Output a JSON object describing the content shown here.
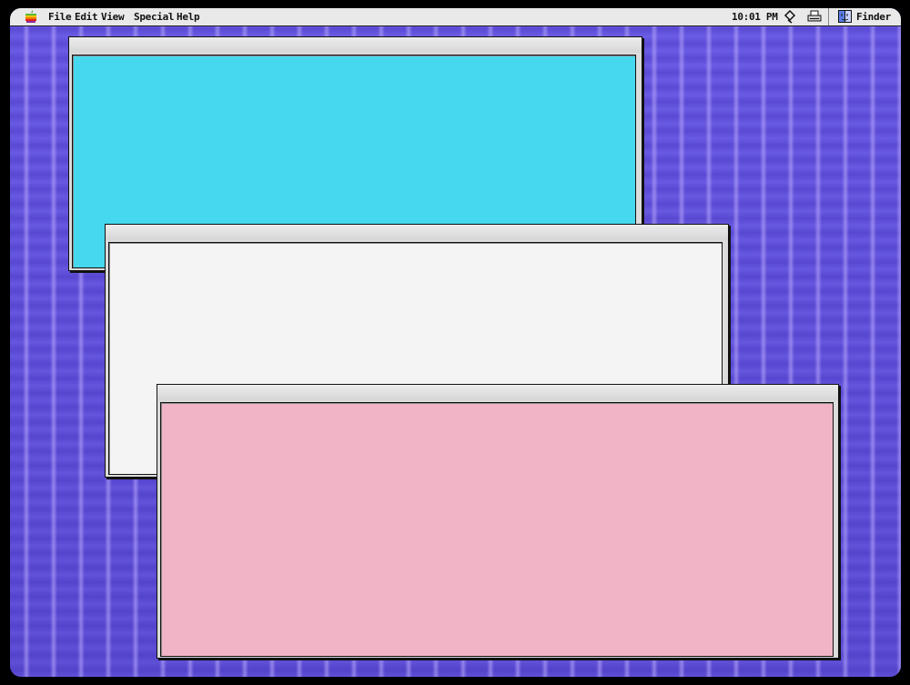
{
  "menubar": {
    "apple_icon": "apple-icon",
    "items": [
      "File",
      "Edit",
      "View",
      "Special",
      "Help"
    ],
    "clock": "10:01 PM",
    "app_label": "Finder",
    "icons": [
      "file-sharing-icon",
      "printer-icon",
      "finder-app-icon"
    ]
  },
  "windows": [
    {
      "name": "cyan-window",
      "fill": "#46d8ee"
    },
    {
      "name": "white-window",
      "fill": "#f4f4f4"
    },
    {
      "name": "pink-window",
      "fill": "#f0b4c6"
    }
  ],
  "desktop": {
    "background": "#6a5be0"
  }
}
